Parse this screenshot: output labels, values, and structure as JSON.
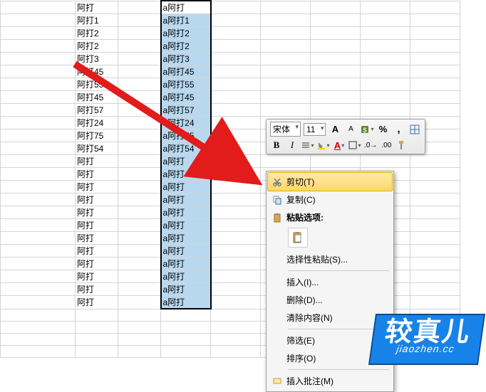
{
  "columns": {
    "b": [
      "阿打",
      "阿打1",
      "阿打2",
      "阿打2",
      "阿打3",
      "阿打45",
      "阿打55",
      "阿打45",
      "阿打57",
      "阿打24",
      "阿打75",
      "阿打54",
      "阿打",
      "阿打",
      "阿打",
      "阿打",
      "阿打",
      "阿打",
      "阿打",
      "阿打",
      "阿打",
      "阿打",
      "阿打",
      "阿打"
    ],
    "d": [
      "a阿打",
      "a阿打1",
      "a阿打2",
      "a阿打2",
      "a阿打3",
      "a阿打45",
      "a阿打55",
      "a阿打45",
      "a阿打57",
      "a阿打24",
      "a阿打75",
      "a阿打54",
      "a阿打",
      "a阿打",
      "a阿打",
      "a阿打",
      "a阿打",
      "a阿打",
      "a阿打",
      "a阿打",
      "a阿打",
      "a阿打",
      "a阿打",
      "a阿打"
    ]
  },
  "toolbar": {
    "font": "宋体",
    "size": "11",
    "incFont": "A",
    "decFont": "A",
    "bold": "B",
    "italic": "I",
    "percent": "%",
    "comma": ","
  },
  "menu": {
    "cut": "剪切(T)",
    "copy": "复制(C)",
    "pasteOptions": "粘贴选项:",
    "pasteSpecial": "选择性粘贴(S)...",
    "insert": "插入(I)...",
    "delete": "删除(D)...",
    "clear": "清除内容(N)",
    "filter": "筛选(E)",
    "sort": "排序(O)",
    "insertComment": "插入批注(M)"
  },
  "watermark": {
    "big": "较真儿",
    "small": "jiaozhen.cc"
  }
}
